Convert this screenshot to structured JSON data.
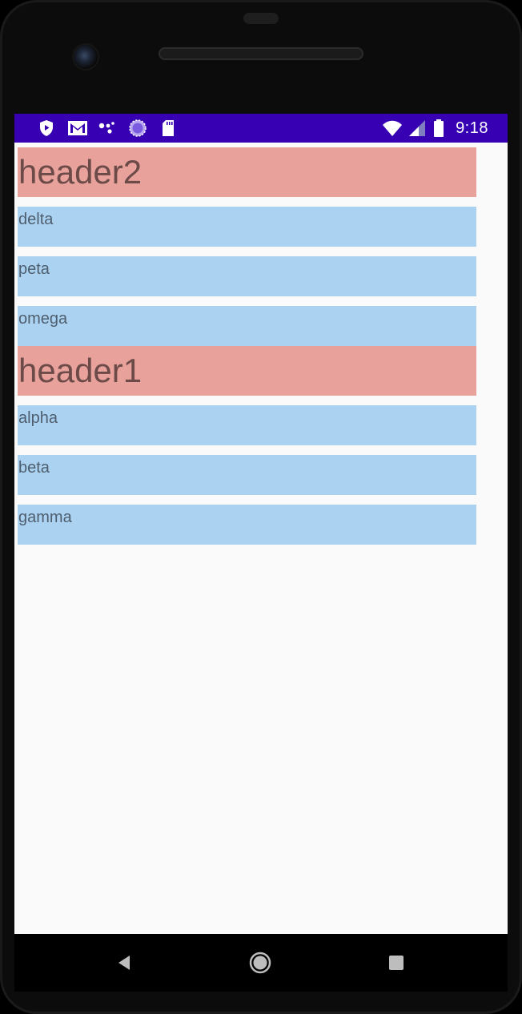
{
  "status_bar": {
    "time": "9:18",
    "background": "#3700b3",
    "notification_icons": [
      "shield-play-icon",
      "gmail-icon",
      "assistant-dots-icon",
      "loading-circle-icon",
      "sd-card-icon"
    ],
    "system_icons": [
      "wifi-icon",
      "signal-icon",
      "battery-icon"
    ]
  },
  "list": {
    "header_color": "#e9a19c",
    "item_color": "#abd2f1",
    "sections": [
      {
        "header": "header2",
        "items": [
          "delta",
          "peta",
          "omega"
        ]
      },
      {
        "header": "header1",
        "items": [
          "alpha",
          "beta",
          "gamma"
        ]
      }
    ]
  },
  "navigation_bar": {
    "buttons": [
      "back-icon",
      "home-icon",
      "recents-icon"
    ]
  }
}
